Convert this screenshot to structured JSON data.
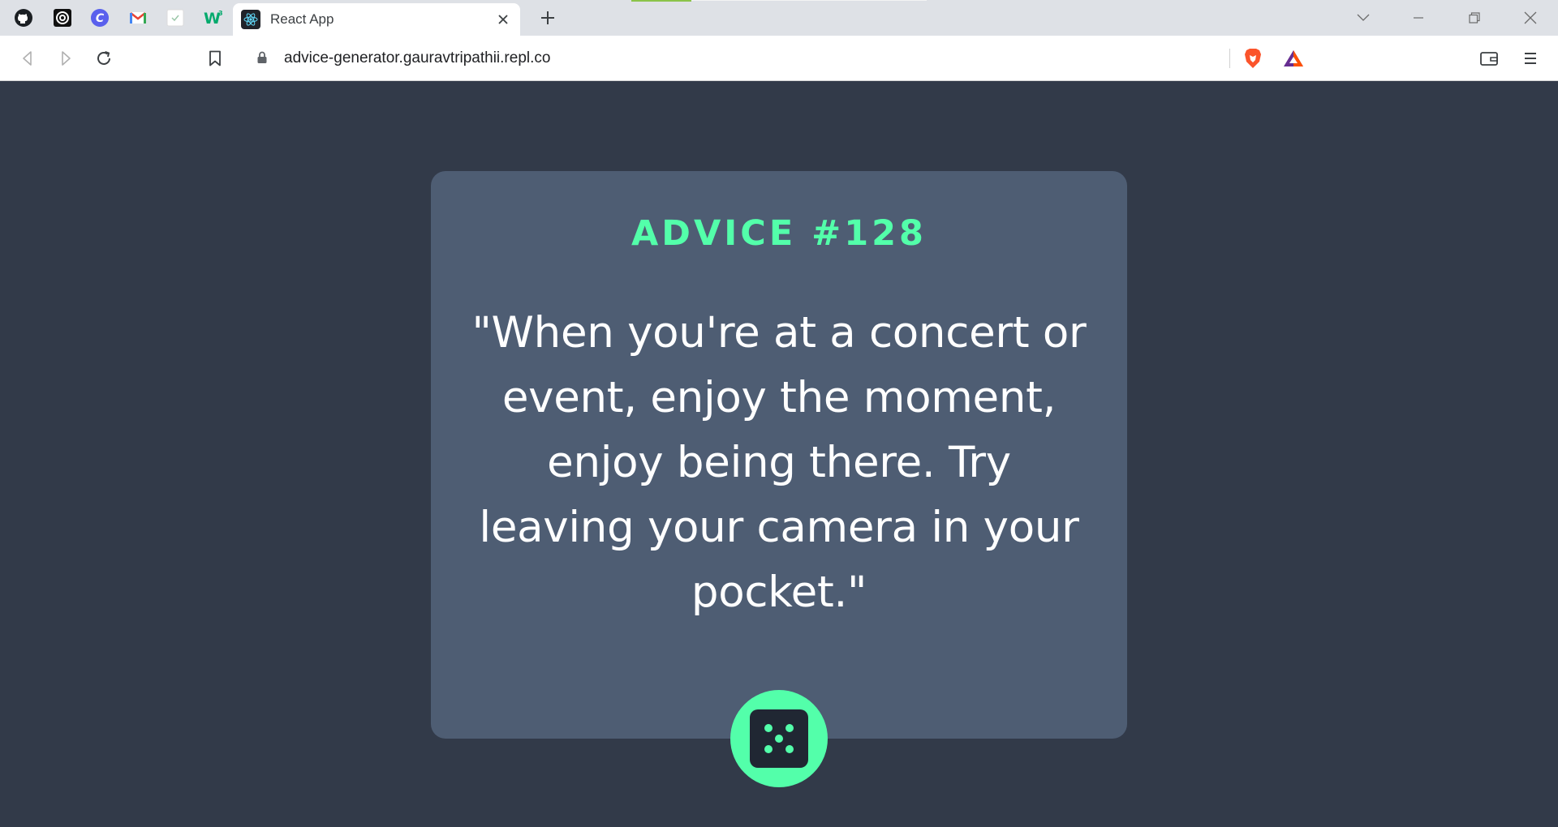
{
  "browser": {
    "pinned_tabs": [
      {
        "icon": "github-icon"
      },
      {
        "icon": "spiral-icon"
      },
      {
        "icon": "canva-icon"
      },
      {
        "icon": "gmail-icon"
      },
      {
        "icon": "page-icon"
      },
      {
        "icon": "w3-icon"
      }
    ],
    "active_tab": {
      "title": "React App",
      "icon": "react-icon"
    },
    "address": "advice-generator.gauravtripathii.repl.co"
  },
  "advice": {
    "heading": "ADVICE #128",
    "text": "\"When you're at a concert or event, enjoy the moment, enjoy being there. Try leaving your camera in your pocket.\""
  },
  "colors": {
    "accent": "#53ffaa",
    "card": "#4e5d73",
    "background": "#323a49",
    "dice_face": "#202733"
  }
}
